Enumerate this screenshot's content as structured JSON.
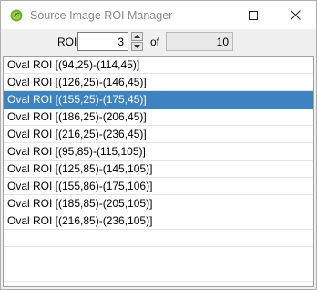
{
  "window": {
    "title": "Source Image ROI Manager",
    "icon": "green-leaf-icon"
  },
  "controls": {
    "roi_label": "ROI",
    "roi_value": "3",
    "of_label": "of",
    "total_value": "10"
  },
  "list": {
    "selected_index": 2,
    "items": [
      "Oval ROI [(94,25)-(114,45)]",
      "Oval ROI [(126,25)-(146,45)]",
      "Oval ROI [(155,25)-(175,45)]",
      "Oval ROI [(186,25)-(206,45)]",
      "Oval ROI [(216,25)-(236,45)]",
      "Oval ROI [(95,85)-(115,105)]",
      "Oval ROI [(125,85)-(145,105)]",
      "Oval ROI [(155,86)-(175,106)]",
      "Oval ROI [(185,85)-(205,105)]",
      "Oval ROI [(216,85)-(236,105)]",
      "",
      "",
      "",
      ""
    ]
  },
  "colors": {
    "selection": "#3d83c1",
    "window_bg": "#f0f0f0"
  }
}
